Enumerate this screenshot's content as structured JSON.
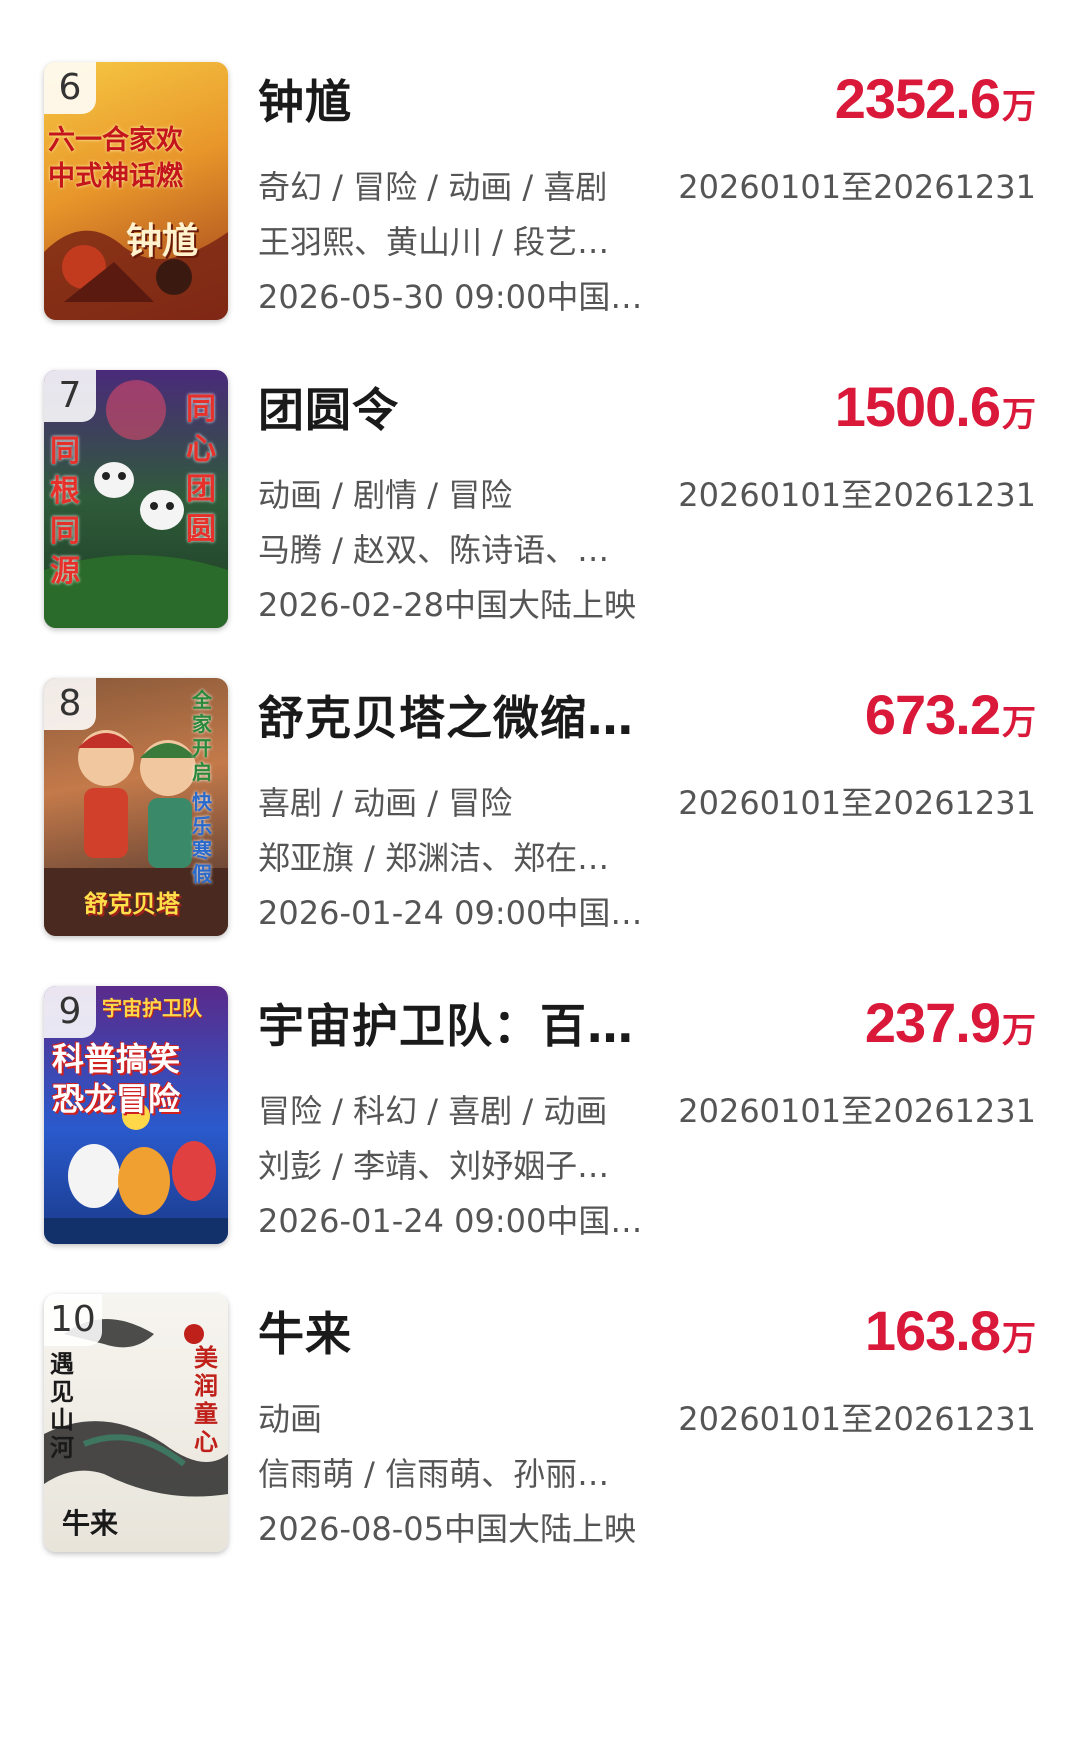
{
  "box_unit": "万",
  "movies": [
    {
      "rank": "6",
      "title": "钟馗",
      "box_office": "2352.6",
      "genres": "奇幻 / 冒险 / 动画 / 喜剧",
      "people": "王羽熙、黄山川 / 段艺…",
      "release": "2026-05-30 09:00中国…",
      "period": "20260101至20261231",
      "poster_lines": [
        "六一合家欢",
        "中式神话燃",
        "钟馗"
      ]
    },
    {
      "rank": "7",
      "title": "团圆令",
      "box_office": "1500.6",
      "genres": "动画 / 剧情 / 冒险",
      "people": "马腾 / 赵双、陈诗语、…",
      "release": "2026-02-28中国大陆上映",
      "period": "20260101至20261231",
      "poster_lines": [
        "同根同源",
        "同心团圆"
      ]
    },
    {
      "rank": "8",
      "title": "舒克贝塔之微缩…",
      "box_office": "673.2",
      "genres": "喜剧 / 动画 / 冒险",
      "people": "郑亚旗 / 郑渊洁、郑在…",
      "release": "2026-01-24 09:00中国…",
      "period": "20260101至20261231",
      "poster_lines": [
        "全家开启",
        "快乐寒假",
        "舒克贝塔"
      ]
    },
    {
      "rank": "9",
      "title": "宇宙护卫队：百…",
      "box_office": "237.9",
      "genres": "冒险 / 科幻 / 喜剧 / 动画",
      "people": "刘彭 / 李靖、刘妤姻子…",
      "release": "2026-01-24 09:00中国…",
      "period": "20260101至20261231",
      "poster_lines": [
        "宇宙护卫队",
        "科普搞笑",
        "恐龙冒险"
      ]
    },
    {
      "rank": "10",
      "title": "牛来",
      "box_office": "163.8",
      "genres": "动画",
      "people": "信雨萌 / 信雨萌、孙丽…",
      "release": "2026-08-05中国大陆上映",
      "period": "20260101至20261231",
      "poster_lines": [
        "遇见山河",
        "美润童心",
        "牛来"
      ]
    }
  ]
}
